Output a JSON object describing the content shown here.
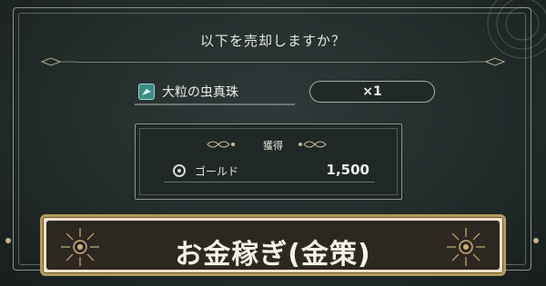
{
  "dialog": {
    "title": "以下を売却しますか？",
    "item_name": "大粒の虫真珠",
    "quantity": "×1",
    "reward_header": "獲得",
    "reward_label": "ゴールド",
    "reward_value": "1,500"
  },
  "banner": {
    "title": "お金稼ぎ(金策)"
  },
  "colors": {
    "background": "#26302f",
    "banner_bg": "#2c2821",
    "banner_border": "#b49a5b",
    "item_icon": "#3b8c84"
  },
  "icons": [
    "item-icon",
    "radio-icon",
    "sun-ornament-icon",
    "gear-deco-icon"
  ]
}
